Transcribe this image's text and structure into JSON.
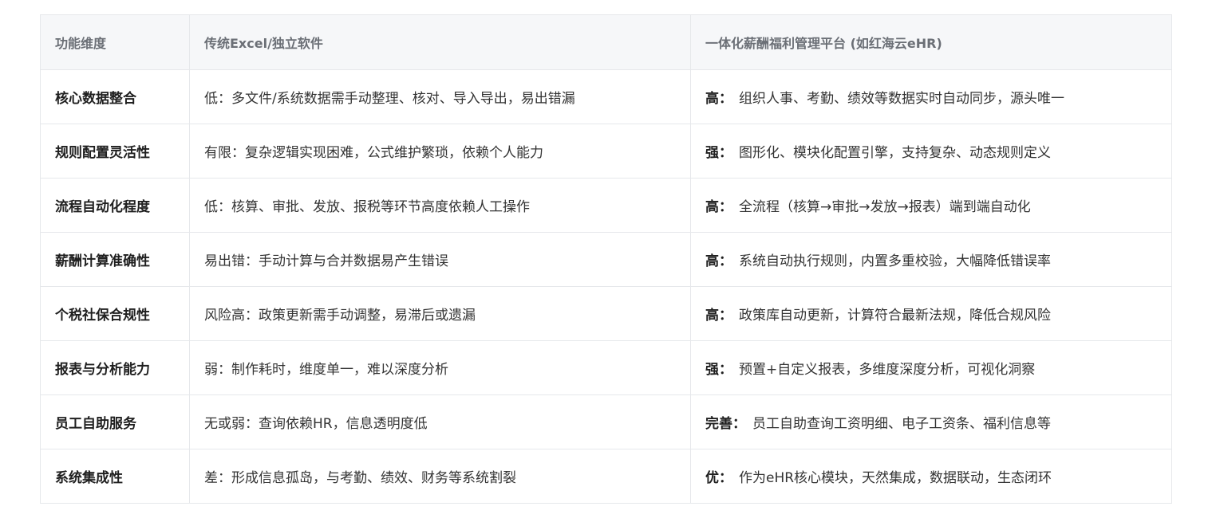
{
  "table": {
    "headers": [
      "功能维度",
      "传统Excel/独立软件",
      "一体化薪酬福利管理平台 (如红海云eHR)"
    ],
    "rows": [
      {
        "dimension": "核心数据整合",
        "traditional": "低：多文件/系统数据需手动整理、核对、导入导出，易出错漏",
        "platform_level": "高：",
        "platform_text": "组织人事、考勤、绩效等数据实时自动同步，源头唯一"
      },
      {
        "dimension": "规则配置灵活性",
        "traditional": "有限：复杂逻辑实现困难，公式维护繁琐，依赖个人能力",
        "platform_level": "强：",
        "platform_text": "图形化、模块化配置引擎，支持复杂、动态规则定义"
      },
      {
        "dimension": "流程自动化程度",
        "traditional": "低：核算、审批、发放、报税等环节高度依赖人工操作",
        "platform_level": "高：",
        "platform_text": "全流程（核算→审批→发放→报表）端到端自动化"
      },
      {
        "dimension": "薪酬计算准确性",
        "traditional": "易出错：手动计算与合并数据易产生错误",
        "platform_level": "高：",
        "platform_text": "系统自动执行规则，内置多重校验，大幅降低错误率"
      },
      {
        "dimension": "个税社保合规性",
        "traditional": "风险高：政策更新需手动调整，易滞后或遗漏",
        "platform_level": "高：",
        "platform_text": "政策库自动更新，计算符合最新法规，降低合规风险"
      },
      {
        "dimension": "报表与分析能力",
        "traditional": "弱：制作耗时，维度单一，难以深度分析",
        "platform_level": "强：",
        "platform_text": "预置+自定义报表，多维度深度分析，可视化洞察"
      },
      {
        "dimension": "员工自助服务",
        "traditional": "无或弱：查询依赖HR，信息透明度低",
        "platform_level": "完善：",
        "platform_text": "员工自助查询工资明细、电子工资条、福利信息等"
      },
      {
        "dimension": "系统集成性",
        "traditional": "差：形成信息孤岛，与考勤、绩效、财务等系统割裂",
        "platform_level": "优：",
        "platform_text": "作为eHR核心模块，天然集成，数据联动，生态闭环"
      }
    ]
  }
}
